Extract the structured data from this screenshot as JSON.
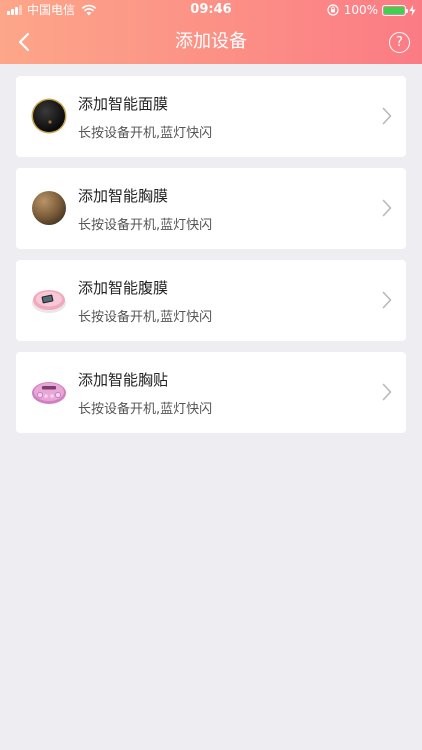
{
  "status_bar": {
    "carrier": "中国电信",
    "time": "09:46",
    "battery": "100%"
  },
  "nav": {
    "title": "添加设备",
    "help_icon": "question-circle-icon",
    "back_icon": "chevron-left-icon"
  },
  "devices": [
    {
      "title": "添加智能面膜",
      "subtitle": "长按设备开机,蓝灯快闪",
      "icon": "face-mask-device-icon"
    },
    {
      "title": "添加智能胸膜",
      "subtitle": "长按设备开机,蓝灯快闪",
      "icon": "chest-mask-device-icon"
    },
    {
      "title": "添加智能腹膜",
      "subtitle": "长按设备开机,蓝灯快闪",
      "icon": "belly-mask-device-icon"
    },
    {
      "title": "添加智能胸贴",
      "subtitle": "长按设备开机,蓝灯快闪",
      "icon": "chest-patch-device-icon"
    }
  ],
  "colors": {
    "header_gradient_start": "#fda689",
    "header_gradient_end": "#fb7b85",
    "background": "#ededf2"
  }
}
